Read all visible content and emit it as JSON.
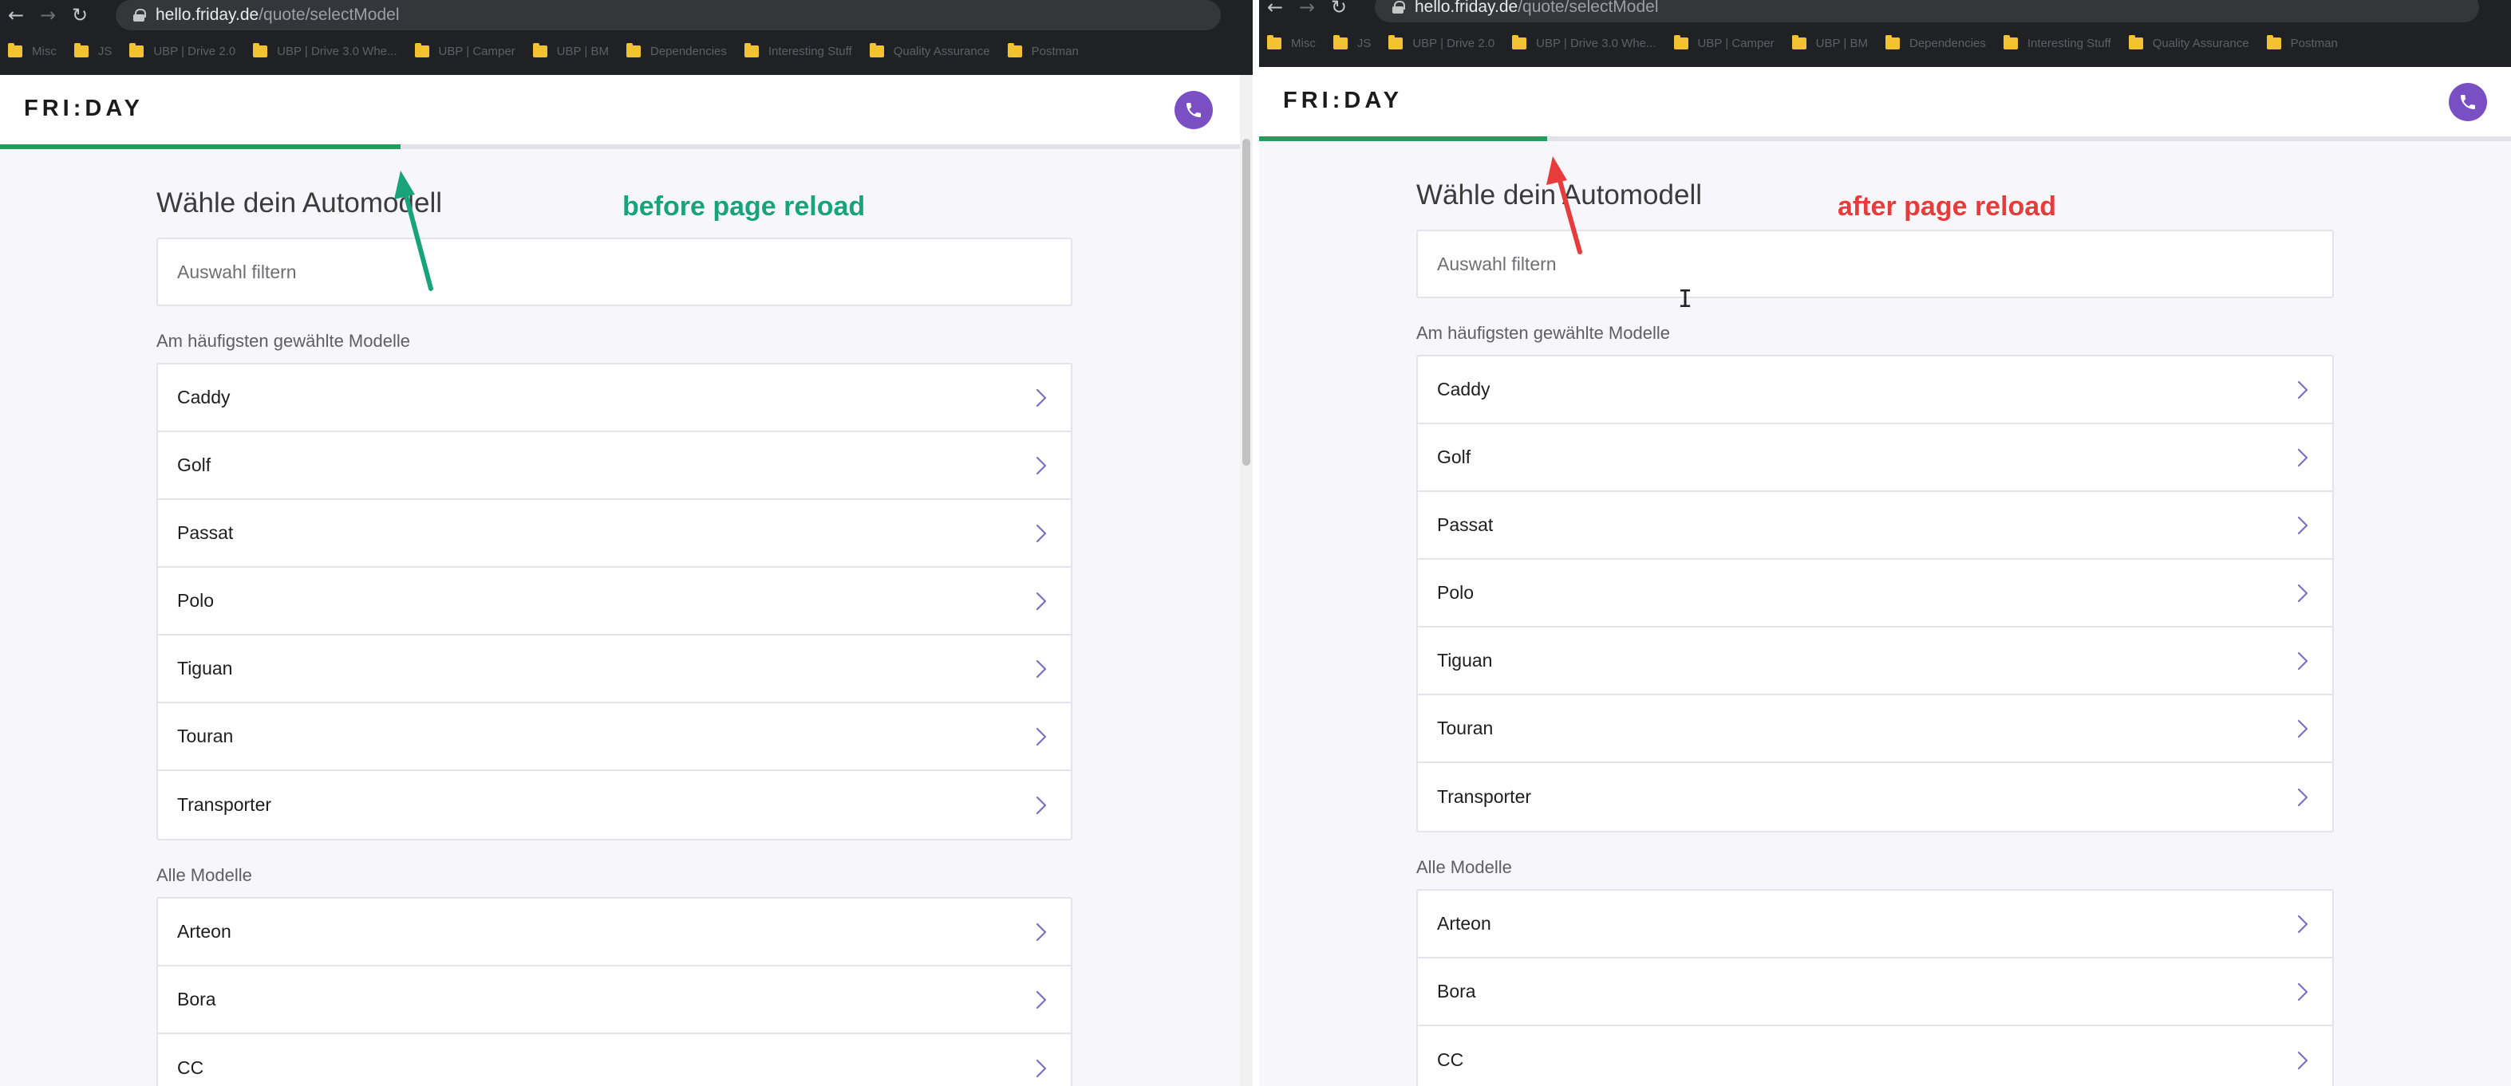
{
  "browser": {
    "url_host": "hello.friday.de",
    "url_path": "/quote/selectModel",
    "bookmarks": [
      "Misc",
      "JS",
      "UBP | Drive 2.0",
      "UBP | Drive 3.0 Whe...",
      "UBP | Camper",
      "UBP | BM",
      "Dependencies",
      "Interesting Stuff",
      "Quality Assurance",
      "Postman"
    ]
  },
  "page": {
    "logo": "FRI:DAY",
    "heading": "Wähle dein Automodell",
    "filter_placeholder": "Auswahl filtern",
    "popular_label": "Am häufigsten gewählte Modelle",
    "popular_models": [
      "Caddy",
      "Golf",
      "Passat",
      "Polo",
      "Tiguan",
      "Touran",
      "Transporter"
    ],
    "all_label": "Alle Modelle",
    "all_models": [
      "Arteon",
      "Bora",
      "CC"
    ]
  },
  "panes": {
    "left": {
      "annotation": "before page reload",
      "progress": 0.32
    },
    "right": {
      "annotation": "after page reload",
      "progress": 0.23
    }
  },
  "colors": {
    "accent_purple": "#7b4fc4",
    "progress_green": "#1f9e5c",
    "annotation_green": "#18a37a",
    "annotation_red": "#e83b3b"
  },
  "icons": {
    "phone": "phone-icon",
    "chevron": "chevron-right-icon",
    "lock": "lock-icon",
    "folder": "folder-icon"
  }
}
